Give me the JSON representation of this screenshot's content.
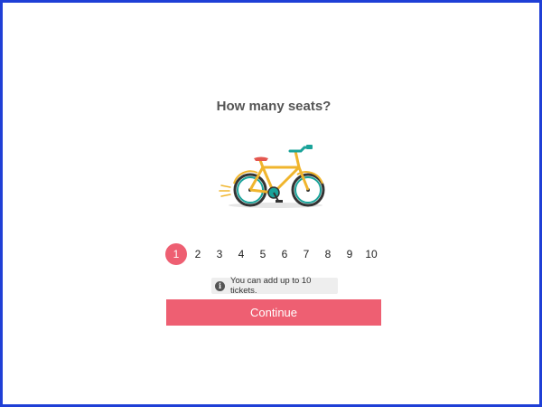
{
  "page": {
    "title": "How many seats?"
  },
  "illustration": {
    "icon": "bicycle-icon"
  },
  "seat_selector": {
    "options": [
      "1",
      "2",
      "3",
      "4",
      "5",
      "6",
      "7",
      "8",
      "9",
      "10"
    ],
    "selected": "1"
  },
  "info": {
    "icon": "info-icon",
    "text": "You can add up to 10 tickets."
  },
  "actions": {
    "continue_label": "Continue"
  },
  "colors": {
    "accent": "#ee5f72",
    "frame": "#1f3fd6",
    "bike_frame": "#f0b52d",
    "wheel": "#1aa39a"
  }
}
